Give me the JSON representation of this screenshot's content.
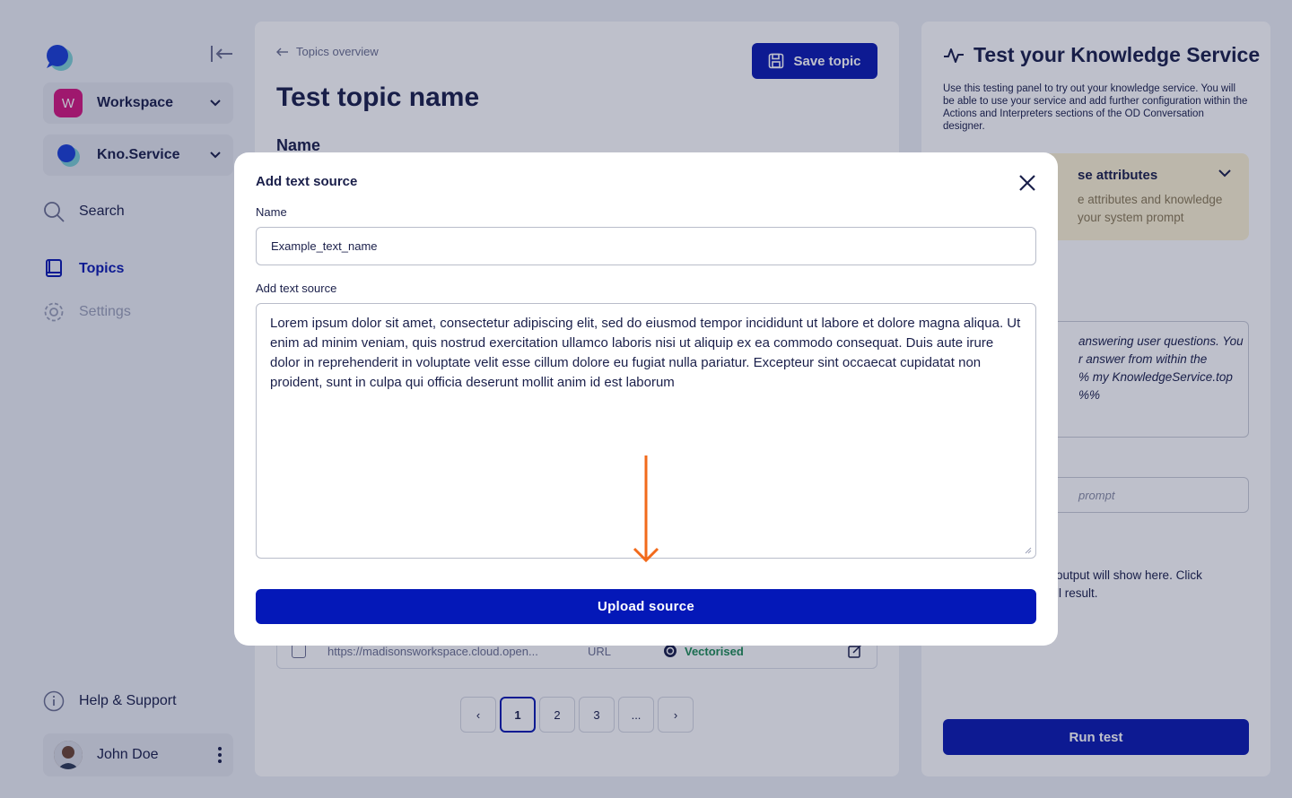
{
  "sidebar": {
    "workspace_badge": "W",
    "workspace_label": "Workspace",
    "service_label": "Kno.Service",
    "nav": {
      "search": "Search",
      "topics": "Topics",
      "settings": "Settings",
      "help": "Help & Support"
    },
    "user_name": "John Doe"
  },
  "main": {
    "breadcrumb": "Topics overview",
    "save_label": "Save topic",
    "title": "Test topic name",
    "name_heading": "Name",
    "source_row": {
      "url": "https://madisonsworkspace.cloud.open...",
      "type": "URL",
      "status": "Vectorised"
    },
    "pagination": [
      "1",
      "2",
      "3",
      "...",
      "‹",
      "›"
    ]
  },
  "right_panel": {
    "title": "Test your Knowledge Service",
    "description": "Use this testing panel to try out your knowledge service. You will be able to use your service and add further configuration within the Actions and Interpreters sections of the OD Conversation designer.",
    "attr_title": "se attributes",
    "attr_sub_1": "e attributes and knowledge",
    "attr_sub_2": "your system prompt",
    "prompt_line_1": "answering user questions. You",
    "prompt_line_2": "r answer from within the",
    "prompt_line_3": "% my KnowledgeService.top %%",
    "input_placeholder": "prompt",
    "output_line_1": "output will show here. Click",
    "output_line_2": "ll result.",
    "run_label": "Run test"
  },
  "modal": {
    "title": "Add text source",
    "name_label": "Name",
    "name_value": "Example_text_name",
    "source_label": "Add text source",
    "source_value": "Lorem ipsum dolor sit amet, consectetur adipiscing elit, sed do eiusmod tempor incididunt ut labore et dolore magna aliqua. Ut enim ad minim veniam, quis nostrud exercitation ullamco laboris nisi ut aliquip ex ea commodo consequat. Duis aute irure dolor in reprehenderit in voluptate velit esse cillum dolore eu fugiat nulla pariatur. Excepteur sint occaecat cupidatat non proident, sunt in culpa qui officia deserunt mollit anim id est laborum",
    "upload_label": "Upload source"
  },
  "colors": {
    "primary": "#0a1ab0",
    "annotation_arrow": "#f26a1b",
    "workspace_badge": "#d4177f",
    "attr_box": "#fdf3d3",
    "vectorised": "#1e8c55"
  }
}
